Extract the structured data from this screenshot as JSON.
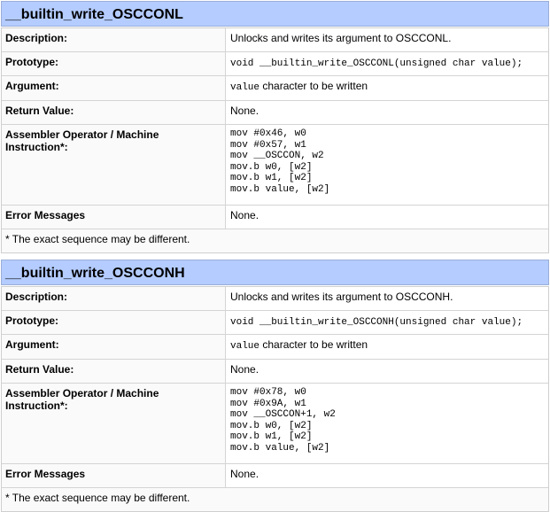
{
  "sections": [
    {
      "title": "__builtin_write_OSCCONL",
      "rows": {
        "description": {
          "label": "Description:",
          "value": "Unlocks and writes its argument to OSCCONL."
        },
        "prototype": {
          "label": "Prototype:",
          "value": "void __builtin_write_OSCCONL(unsigned char value);"
        },
        "argument": {
          "label": "Argument:",
          "code": "value",
          "text": " character to be written"
        },
        "return_value": {
          "label": "Return Value:",
          "value": "None."
        },
        "assembler": {
          "label": "Assembler Operator / Machine Instruction*:",
          "lines": [
            "mov #0x46, w0",
            "mov #0x57, w1",
            "mov __OSCCON, w2",
            "mov.b w0, [w2]",
            "mov.b w1, [w2]",
            "mov.b value, [w2]"
          ]
        },
        "error_messages": {
          "label": "Error Messages",
          "value": "None."
        }
      },
      "note": "* The exact sequence may be different."
    },
    {
      "title": "__builtin_write_OSCCONH",
      "rows": {
        "description": {
          "label": "Description:",
          "value": "Unlocks and writes its argument to OSCCONH."
        },
        "prototype": {
          "label": "Prototype:",
          "value": "void __builtin_write_OSCCONH(unsigned char value);"
        },
        "argument": {
          "label": "Argument:",
          "code": "value",
          "text": " character to be written"
        },
        "return_value": {
          "label": "Return Value:",
          "value": "None."
        },
        "assembler": {
          "label": "Assembler Operator / Machine Instruction*:",
          "lines": [
            "mov #0x78, w0",
            "mov #0x9A, w1",
            "mov __OSCCON+1, w2",
            "mov.b w0, [w2]",
            "mov.b w1, [w2]",
            "mov.b value, [w2]"
          ]
        },
        "error_messages": {
          "label": "Error Messages",
          "value": "None."
        }
      },
      "note": "* The exact sequence may be different."
    }
  ]
}
